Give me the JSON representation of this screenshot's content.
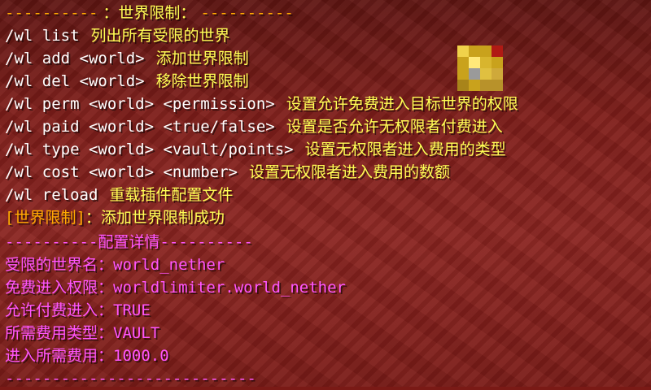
{
  "header": {
    "dashes_left": "----------",
    "title": "：世界限制：",
    "dashes_right": "----------"
  },
  "commands": [
    {
      "cmd": "/wl list",
      "desc": "列出所有受限的世界"
    },
    {
      "cmd": "/wl add <world>",
      "desc": "添加世界限制"
    },
    {
      "cmd": "/wl del <world>",
      "desc": "移除世界限制"
    },
    {
      "cmd": "/wl perm <world> <permission>",
      "desc": "设置允许免费进入目标世界的权限"
    },
    {
      "cmd": "/wl paid <world> <true/false>",
      "desc": "设置是否允许无权限者付费进入"
    },
    {
      "cmd": "/wl type <world> <vault/points>",
      "desc": "设置无权限者进入费用的类型"
    },
    {
      "cmd": "/wl cost <world> <number>",
      "desc": "设置无权限者进入费用的数额"
    },
    {
      "cmd": "/wl reload",
      "desc": "重载插件配置文件"
    }
  ],
  "message": {
    "prefix": "[世界限制]",
    "text": "：添加世界限制成功"
  },
  "details_header": {
    "dashes_left": "----------",
    "title": "配置详情",
    "dashes_right": "----------"
  },
  "details": [
    {
      "label": "受限的世界名：",
      "value": "world_nether"
    },
    {
      "label": "免费进入权限：",
      "value": "worldlimiter.world_nether"
    },
    {
      "label": "允许付费进入：",
      "value": "TRUE"
    },
    {
      "label": "所需费用类型：",
      "value": "VAULT"
    },
    {
      "label": "进入所需费用：",
      "value": "1000.0"
    }
  ],
  "footer": {
    "dashes": "---------------------------"
  },
  "colors": {
    "gold": "#ffaa00",
    "yellow": "#ffff55",
    "white": "#ffffff",
    "pink": "#ff55ff",
    "background": "#7a1a16"
  },
  "icons": {
    "block": "gold-ore-block-icon"
  }
}
